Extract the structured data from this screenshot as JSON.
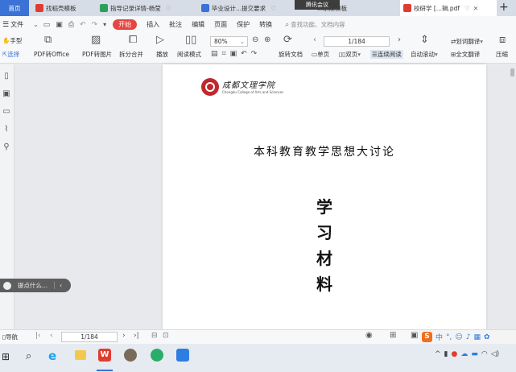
{
  "tabs": {
    "home": "首页",
    "t1": "找稻壳模板",
    "t2": "指导记录详情-杨莹",
    "t3": "毕业设计...提交要求",
    "t4": "...求及模板",
    "t5": "校研学 [...辑.pdf",
    "overlay": "腾讯会议"
  },
  "menu": {
    "file": "文件",
    "start": "开始",
    "insert": "插入",
    "annotate": "批注",
    "edit": "编辑",
    "page": "页面",
    "protect": "保护",
    "convert": "转换",
    "search_placeholder": "查找功能、文档内容"
  },
  "toolbar": {
    "hand": "手型",
    "select": "选择",
    "pdf_office": "PDF转Office",
    "pdf_image": "PDF转图片",
    "split_merge": "拆分合并",
    "play": "播放",
    "read_mode": "阅读模式",
    "zoom": "80%",
    "rotate": "旋转文档",
    "page_num": "1/184",
    "single": "单页",
    "double": "双页",
    "continuous": "连续阅读",
    "auto_scroll": "自动滚动",
    "translate_word": "划词翻译",
    "translate_full": "全文翻译",
    "compress": "压缩"
  },
  "document": {
    "college_name": "成都文理学院",
    "college_en": "Chengdu College of Arts and Sciences",
    "heading": "本科教育教学思想大讨论",
    "vertical_title": [
      "学",
      "习",
      "材",
      "料"
    ]
  },
  "assistant": {
    "bubble": "提点什么..."
  },
  "statusbar": {
    "nav": "导航",
    "page": "1/184"
  },
  "colors": {
    "accent": "#3a72d6",
    "start_red": "#e7453f"
  }
}
